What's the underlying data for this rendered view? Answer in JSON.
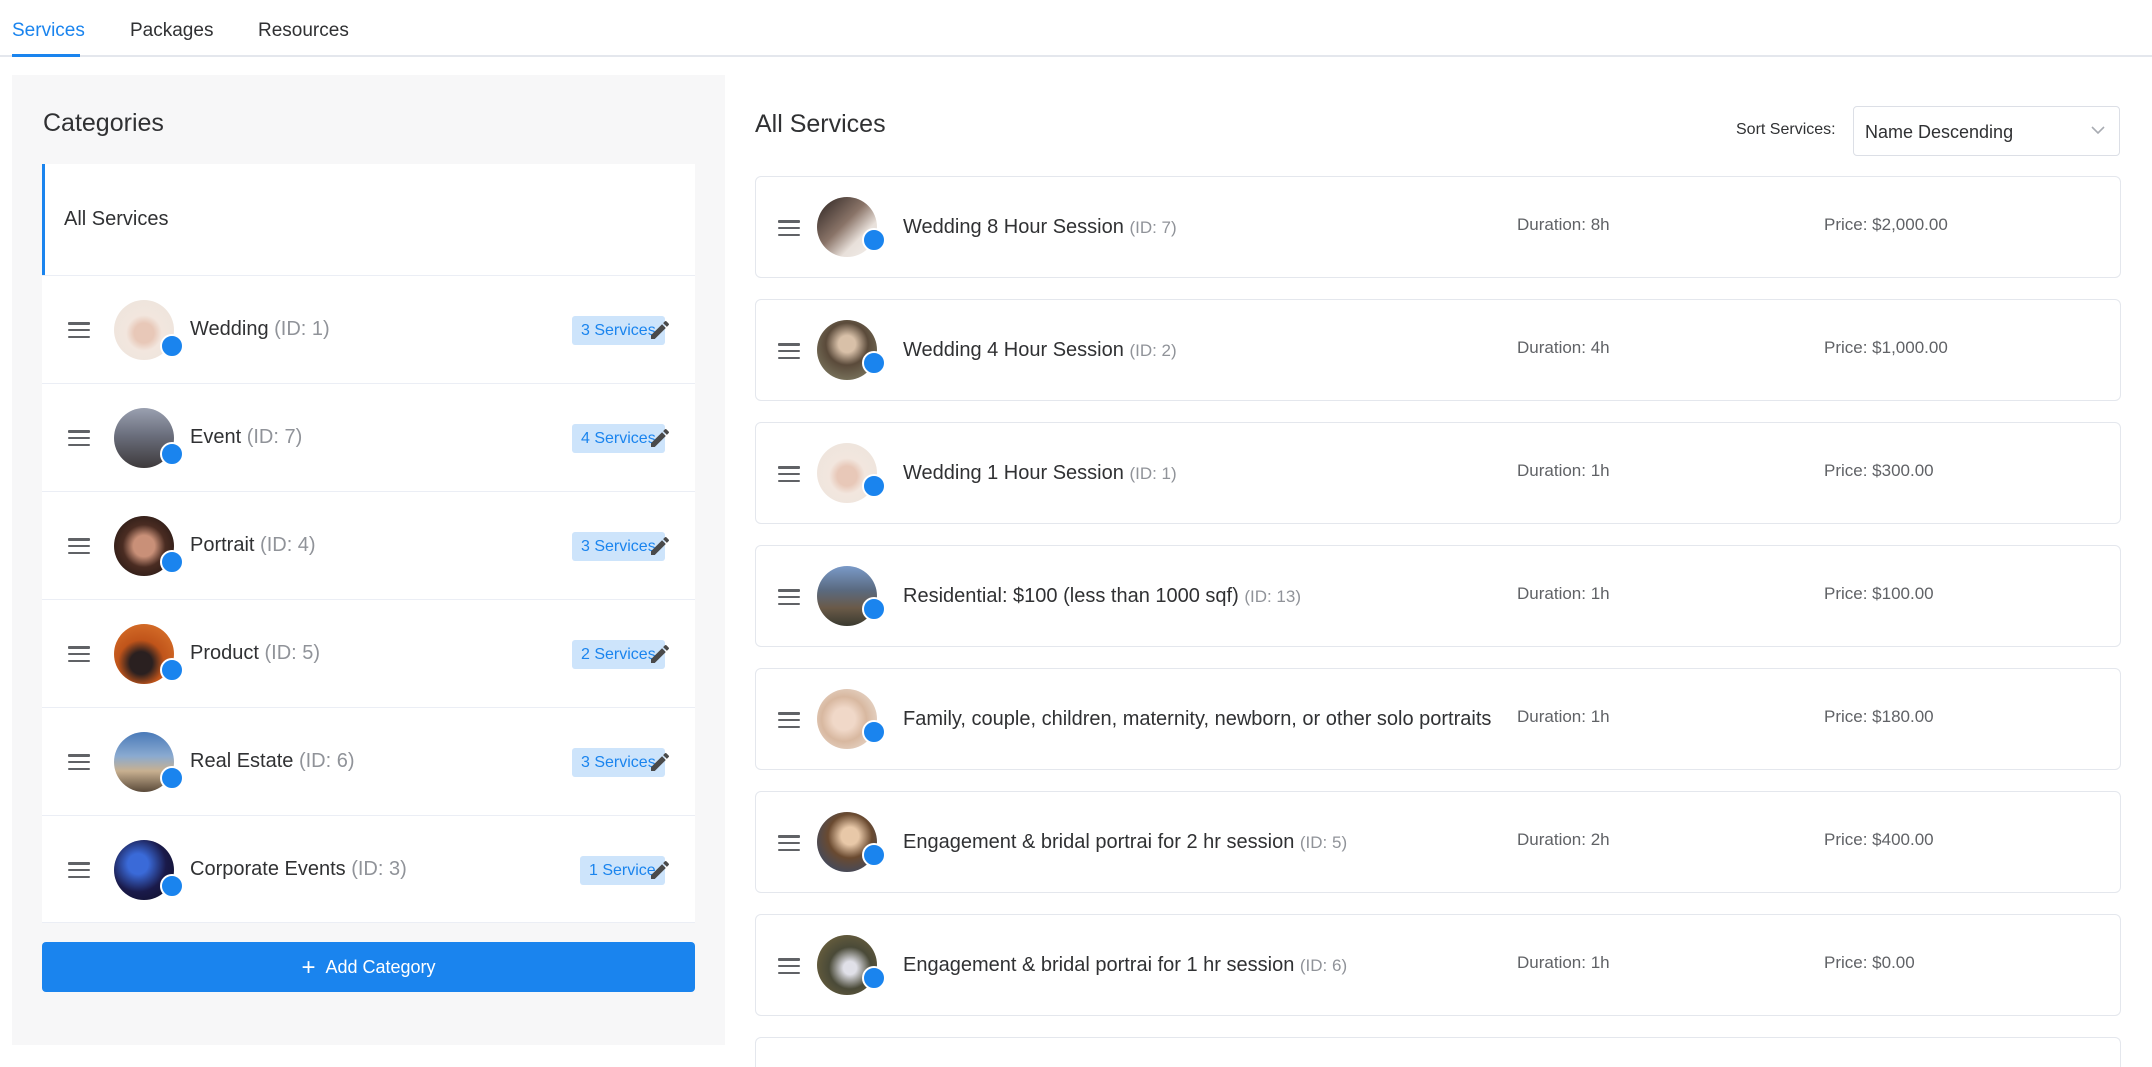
{
  "tabs": [
    {
      "label": "Services",
      "active": true
    },
    {
      "label": "Packages",
      "active": false
    },
    {
      "label": "Resources",
      "active": false
    }
  ],
  "categories": {
    "title": "Categories",
    "all_label": "All Services",
    "items": [
      {
        "name": "Wedding",
        "id": "(ID: 1)",
        "badge": "3 Services"
      },
      {
        "name": "Event",
        "id": "(ID: 7)",
        "badge": "4 Services"
      },
      {
        "name": "Portrait",
        "id": "(ID: 4)",
        "badge": "3 Services"
      },
      {
        "name": "Product",
        "id": "(ID: 5)",
        "badge": "2 Services"
      },
      {
        "name": "Real Estate",
        "id": "(ID: 6)",
        "badge": "3 Services"
      },
      {
        "name": "Corporate Events",
        "id": "(ID: 3)",
        "badge": "1 Service"
      }
    ],
    "add_button": "Add Category"
  },
  "services": {
    "title": "All Services",
    "sort_label": "Sort Services:",
    "sort_value": "Name Descending",
    "items": [
      {
        "name": "Wedding 8 Hour Session",
        "id": "(ID: 7)",
        "duration": "Duration: 8h",
        "price": "Price: $2,000.00"
      },
      {
        "name": "Wedding 4 Hour Session",
        "id": "(ID: 2)",
        "duration": "Duration: 4h",
        "price": "Price: $1,000.00"
      },
      {
        "name": "Wedding 1 Hour Session",
        "id": "(ID: 1)",
        "duration": "Duration: 1h",
        "price": "Price: $300.00"
      },
      {
        "name": "Residential: $100 (less than 1000 sqf)",
        "id": "(ID: 13)",
        "duration": "Duration: 1h",
        "price": "Price: $100.00"
      },
      {
        "name": "Family, couple, children, maternity, newborn, or other solo portraits",
        "id": "",
        "duration": "Duration: 1h",
        "price": "Price: $180.00"
      },
      {
        "name": "Engagement & bridal portrai for 2 hr session",
        "id": "(ID: 5)",
        "duration": "Duration: 2h",
        "price": "Price: $400.00"
      },
      {
        "name": "Engagement & bridal portrai for 1 hr session",
        "id": "(ID: 6)",
        "duration": "Duration: 1h",
        "price": "Price: $0.00"
      }
    ]
  },
  "colors": {
    "accent": "#1a84ee",
    "badge_bg": "#cde4fb",
    "panel_bg": "#f7f7f8"
  },
  "icons": {
    "drag": "drag-handle-icon",
    "edit": "pencil-icon",
    "sort": "chevron-down-icon",
    "add": "plus-icon"
  }
}
